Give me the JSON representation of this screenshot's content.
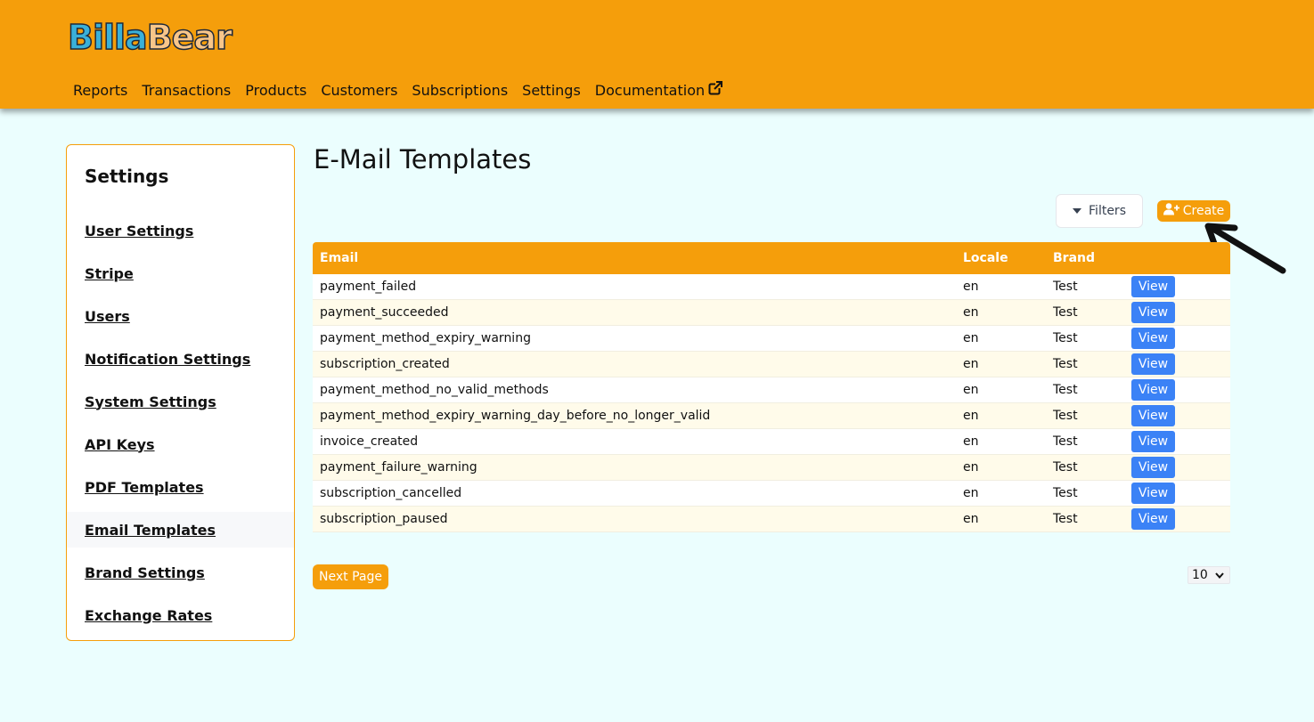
{
  "header": {
    "logo": {
      "part1": "Billa",
      "part2": "Bear"
    },
    "nav": [
      {
        "label": "Reports"
      },
      {
        "label": "Transactions"
      },
      {
        "label": "Products"
      },
      {
        "label": "Customers"
      },
      {
        "label": "Subscriptions"
      },
      {
        "label": "Settings"
      },
      {
        "label": "Documentation",
        "icon": "external-link-icon"
      }
    ]
  },
  "sidebar": {
    "title": "Settings",
    "items": [
      {
        "label": "User Settings"
      },
      {
        "label": "Stripe"
      },
      {
        "label": "Users"
      },
      {
        "label": "Notification Settings"
      },
      {
        "label": "System Settings"
      },
      {
        "label": "API Keys"
      },
      {
        "label": "PDF Templates"
      },
      {
        "label": "Email Templates",
        "active": true
      },
      {
        "label": "Brand Settings"
      },
      {
        "label": "Exchange Rates"
      }
    ]
  },
  "main": {
    "title": "E-Mail Templates",
    "filters_label": "Filters",
    "create_label": "Create",
    "table": {
      "columns": [
        "Email",
        "Locale",
        "Brand",
        ""
      ],
      "rows": [
        {
          "email": "payment_failed",
          "locale": "en",
          "brand": "Test",
          "action": "View"
        },
        {
          "email": "payment_succeeded",
          "locale": "en",
          "brand": "Test",
          "action": "View"
        },
        {
          "email": "payment_method_expiry_warning",
          "locale": "en",
          "brand": "Test",
          "action": "View"
        },
        {
          "email": "subscription_created",
          "locale": "en",
          "brand": "Test",
          "action": "View"
        },
        {
          "email": "payment_method_no_valid_methods",
          "locale": "en",
          "brand": "Test",
          "action": "View"
        },
        {
          "email": "payment_method_expiry_warning_day_before_no_longer_valid",
          "locale": "en",
          "brand": "Test",
          "action": "View"
        },
        {
          "email": "invoice_created",
          "locale": "en",
          "brand": "Test",
          "action": "View"
        },
        {
          "email": "payment_failure_warning",
          "locale": "en",
          "brand": "Test",
          "action": "View"
        },
        {
          "email": "subscription_cancelled",
          "locale": "en",
          "brand": "Test",
          "action": "View"
        },
        {
          "email": "subscription_paused",
          "locale": "en",
          "brand": "Test",
          "action": "View"
        }
      ]
    },
    "pagination": {
      "next_label": "Next Page",
      "per_page": "10"
    }
  },
  "colors": {
    "primary": "#f59e0b",
    "background": "#ebfefe",
    "view_button": "#3b82f6"
  }
}
